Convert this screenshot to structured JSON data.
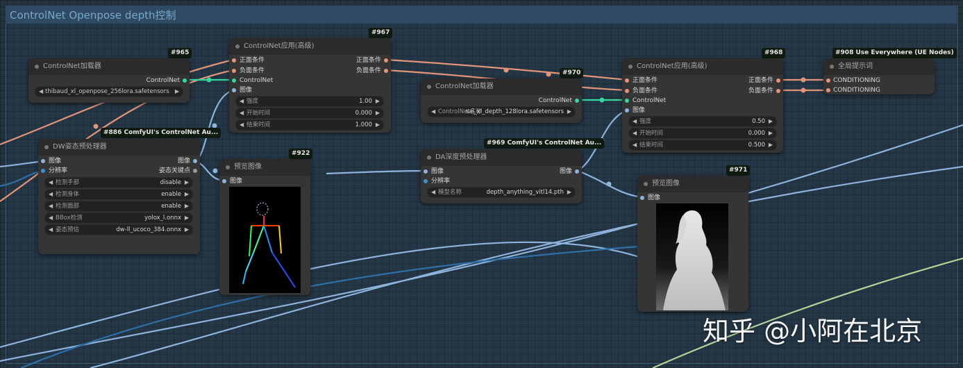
{
  "group": {
    "title": "ControlNet Openpose depth控制"
  },
  "colors": {
    "conditioning": "#e3957a",
    "controlnet": "#36d6a0",
    "image": "#8eb4dd",
    "latent": "#b5d397",
    "node_bg": "#353535",
    "canvas_bg": "#22323f"
  },
  "nodes": {
    "n965": {
      "badge": "#965",
      "title": "ControlNet加载器",
      "outputs": [
        "ControlNet"
      ],
      "widget": {
        "text": "thibaud_xl_openpose_256lora.safetensors",
        "overlap": "ControlNet名称"
      }
    },
    "n967": {
      "badge": "#967",
      "title": "ControlNet应用(高级)",
      "inputs": [
        "正面条件",
        "负面条件",
        "ControlNet",
        "图像"
      ],
      "outputs": [
        "正面条件",
        "负面条件"
      ],
      "widgets": [
        {
          "label": "强度",
          "value": "1.00"
        },
        {
          "label": "开始时间",
          "value": "0.000"
        },
        {
          "label": "结束时间",
          "value": "1.000"
        }
      ]
    },
    "n970": {
      "badge": "#970",
      "title": "ControlNet加载器",
      "outputs": [
        "ControlNet"
      ],
      "widget": {
        "label": "ControlNet名称",
        "value": "sai_xl_depth_128lora.safetensors"
      }
    },
    "n968": {
      "badge": "#968",
      "title": "ControlNet应用(高级)",
      "inputs": [
        "正面条件",
        "负面条件",
        "ControlNet",
        "图像"
      ],
      "outputs": [
        "正面条件",
        "负面条件"
      ],
      "widgets": [
        {
          "label": "强度",
          "value": "0.50"
        },
        {
          "label": "开始时间",
          "value": "0.000"
        },
        {
          "label": "结束时间",
          "value": "0.500"
        }
      ]
    },
    "n908": {
      "badge": "#908 Use Everywhere (UE Nodes)",
      "title": "全局提示词",
      "inputs": [
        "CONDITIONING",
        "CONDITIONING"
      ]
    },
    "n886": {
      "badge": "#886 ComfyUI's ControlNet Au...",
      "title": "DW姿态预处理器",
      "inputs": [
        "图像",
        "分辨率"
      ],
      "outputs": [
        "图像",
        "姿态关键点"
      ],
      "widgets": [
        {
          "label": "检测手部",
          "value": "disable"
        },
        {
          "label": "检测身体",
          "value": "enable"
        },
        {
          "label": "检测面部",
          "value": "enable"
        },
        {
          "label": "BBox检测",
          "value": "yolox_l.onnx"
        },
        {
          "label": "姿态预估",
          "value": "dw-ll_ucoco_384.onnx"
        }
      ]
    },
    "n922": {
      "badge": "#922",
      "title": "预览图像",
      "inputs": [
        "图像"
      ]
    },
    "n969": {
      "badge": "#969 ComfyUI's ControlNet Au...",
      "title": "DA深度预处理器",
      "inputs": [
        "图像",
        "分辨率"
      ],
      "outputs": [
        "图像"
      ],
      "widgets": [
        {
          "label": "模型名称",
          "value": "depth_anything_vitl14.pth"
        }
      ]
    },
    "n971": {
      "badge": "#971",
      "title": "预览图像",
      "inputs": [
        "图像"
      ]
    }
  },
  "watermark": "知乎 @小阿在北京"
}
